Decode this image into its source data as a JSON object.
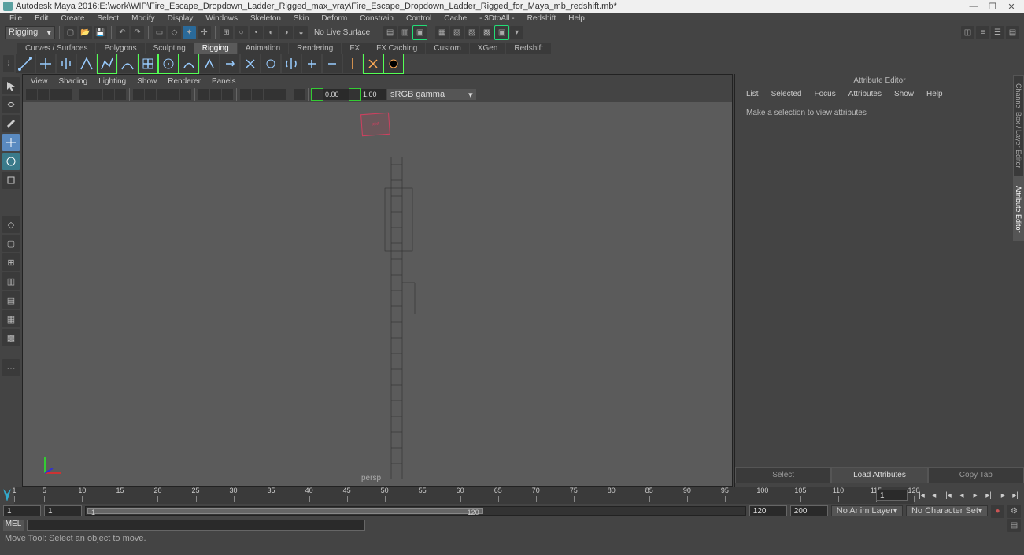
{
  "title": {
    "app": "Autodesk Maya 2016",
    "path": "E:\\work\\WIP\\Fire_Escape_Dropdown_Ladder_Rigged_max_vray\\Fire_Escape_Dropdown_Ladder_Rigged_for_Maya_mb_redshift.mb*"
  },
  "menubar": [
    "File",
    "Edit",
    "Create",
    "Select",
    "Modify",
    "Display",
    "Windows",
    "Skeleton",
    "Skin",
    "Deform",
    "Constrain",
    "Control",
    "Cache",
    "- 3DtoAll -",
    "Redshift",
    "Help"
  ],
  "workspace": "Rigging",
  "toolbar1_right_nolive": "No Live Surface",
  "shelftabs": [
    "Curves / Surfaces",
    "Polygons",
    "Sculpting",
    "Rigging",
    "Animation",
    "Rendering",
    "FX",
    "FX Caching",
    "Custom",
    "XGen",
    "Redshift"
  ],
  "shelftab_active_index": 3,
  "viewport_menu": [
    "View",
    "Shading",
    "Lighting",
    "Show",
    "Renderer",
    "Panels"
  ],
  "viewport_toolbar": {
    "near": "0.00",
    "far": "1.00",
    "gamma": "sRGB gamma"
  },
  "viewport_camera": "persp",
  "attr_editor": {
    "title": "Attribute Editor",
    "menu": [
      "List",
      "Selected",
      "Focus",
      "Attributes",
      "Show",
      "Help"
    ],
    "message": "Make a selection to view attributes",
    "tabs": [
      "Select",
      "Load Attributes",
      "Copy Tab"
    ],
    "active_tab_index": 1
  },
  "side_tabs": [
    "Channel Box / Layer Editor",
    "Attribute Editor"
  ],
  "side_tab_active_index": 1,
  "timeline": {
    "start": 1,
    "end": 120,
    "labels": [
      1,
      5,
      10,
      15,
      20,
      25,
      30,
      35,
      40,
      45,
      50,
      55,
      60,
      65,
      70,
      75,
      80,
      85,
      90,
      95,
      100,
      105,
      110,
      115,
      120
    ],
    "current": 1
  },
  "range": {
    "anim_start": "1",
    "play_start": "1",
    "play_end": "120",
    "anim_end": "200",
    "anim_layer": "No Anim Layer",
    "char_set": "No Character Set"
  },
  "command": {
    "lang": "MEL"
  },
  "status": "Move Tool: Select an object to move.",
  "range_inner_start": "1",
  "range_inner_end": "120"
}
